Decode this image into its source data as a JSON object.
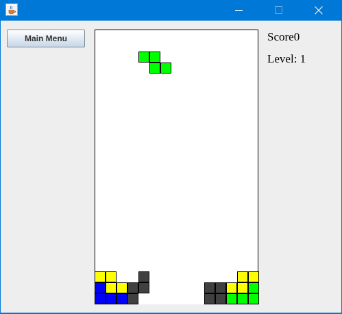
{
  "window": {
    "title": "",
    "icon": "java-cup-icon"
  },
  "controls": {
    "minimize_icon": "minimize-icon",
    "maximize_icon": "maximize-icon",
    "close_icon": "close-icon"
  },
  "sidebar": {
    "main_menu_label": "Main Menu"
  },
  "stats": {
    "score_label": "Score",
    "score_value": "0",
    "level_label": "Level: ",
    "level_value": "1"
  },
  "colors": {
    "green": "#00ff00",
    "yellow": "#ffff00",
    "blue": "#0000ff",
    "gray": "#404040"
  },
  "board": {
    "columns": 15,
    "rows": 25,
    "falling_piece": {
      "shape": "Z",
      "color": "green",
      "cells": [
        [
          4,
          2
        ],
        [
          5,
          2
        ],
        [
          5,
          3
        ],
        [
          6,
          3
        ]
      ]
    },
    "locked_cells": [
      {
        "col": 0,
        "row": 22,
        "color": "yellow"
      },
      {
        "col": 1,
        "row": 22,
        "color": "yellow"
      },
      {
        "col": 4,
        "row": 22,
        "color": "gray"
      },
      {
        "col": 13,
        "row": 22,
        "color": "yellow"
      },
      {
        "col": 14,
        "row": 22,
        "color": "yellow"
      },
      {
        "col": 0,
        "row": 23,
        "color": "blue"
      },
      {
        "col": 1,
        "row": 23,
        "color": "yellow"
      },
      {
        "col": 2,
        "row": 23,
        "color": "yellow"
      },
      {
        "col": 3,
        "row": 23,
        "color": "gray"
      },
      {
        "col": 4,
        "row": 23,
        "color": "gray"
      },
      {
        "col": 10,
        "row": 23,
        "color": "gray"
      },
      {
        "col": 11,
        "row": 23,
        "color": "gray"
      },
      {
        "col": 12,
        "row": 23,
        "color": "yellow"
      },
      {
        "col": 13,
        "row": 23,
        "color": "yellow"
      },
      {
        "col": 14,
        "row": 23,
        "color": "green"
      },
      {
        "col": 0,
        "row": 24,
        "color": "blue"
      },
      {
        "col": 1,
        "row": 24,
        "color": "blue"
      },
      {
        "col": 2,
        "row": 24,
        "color": "blue"
      },
      {
        "col": 3,
        "row": 24,
        "color": "gray"
      },
      {
        "col": 10,
        "row": 24,
        "color": "gray"
      },
      {
        "col": 11,
        "row": 24,
        "color": "gray"
      },
      {
        "col": 12,
        "row": 24,
        "color": "green"
      },
      {
        "col": 13,
        "row": 24,
        "color": "green"
      },
      {
        "col": 14,
        "row": 24,
        "color": "green"
      }
    ]
  }
}
